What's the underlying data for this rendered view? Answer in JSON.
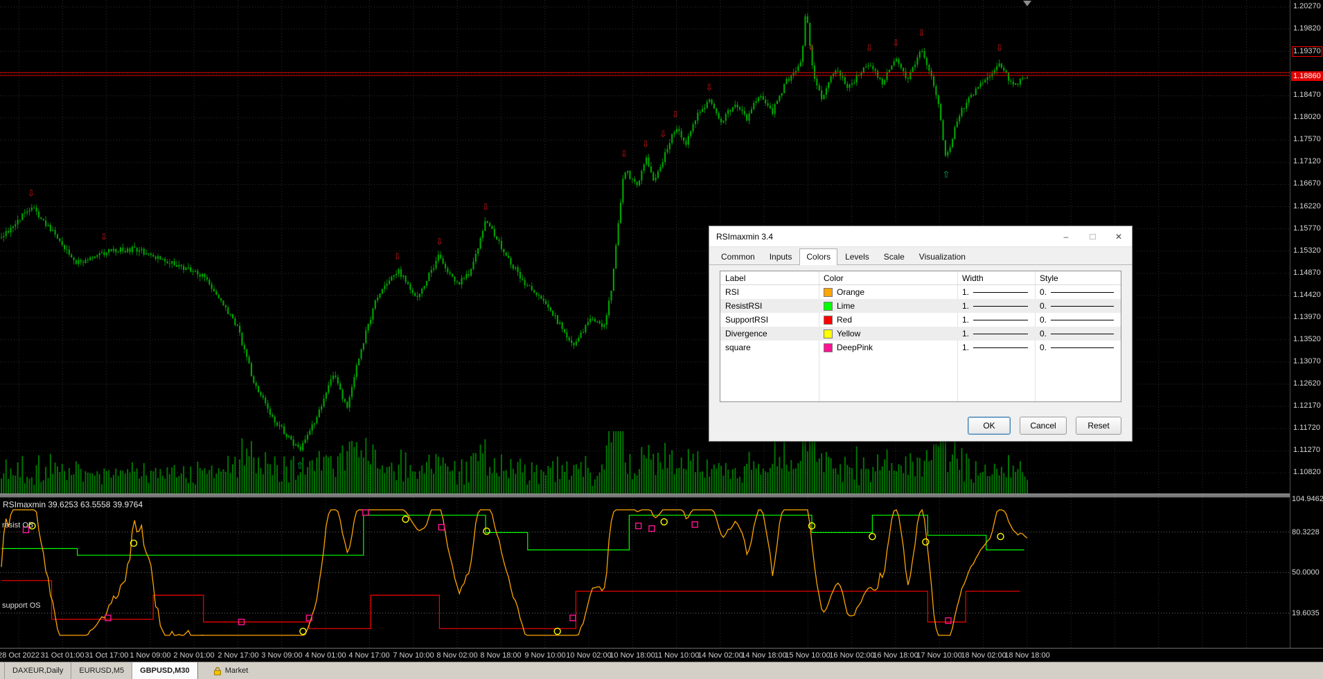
{
  "dialog": {
    "title": "RSImaxmin 3.4",
    "tabs": [
      "Common",
      "Inputs",
      "Colors",
      "Levels",
      "Scale",
      "Visualization"
    ],
    "active_tab": "Colors",
    "table": {
      "headers": [
        "Label",
        "Color",
        "Width",
        "Style"
      ],
      "rows": [
        {
          "label": "RSI",
          "color_name": "Orange",
          "color_hex": "#FFA500",
          "width": "1.",
          "style": "0."
        },
        {
          "label": "ResistRSI",
          "color_name": "Lime",
          "color_hex": "#00FF00",
          "width": "1.",
          "style": "0."
        },
        {
          "label": "SupportRSI",
          "color_name": "Red",
          "color_hex": "#FF0000",
          "width": "1.",
          "style": "0."
        },
        {
          "label": "Divergence",
          "color_name": "Yellow",
          "color_hex": "#FFFF00",
          "width": "1.",
          "style": "0."
        },
        {
          "label": "square",
          "color_name": "DeepPink",
          "color_hex": "#FF1493",
          "width": "1.",
          "style": "0."
        }
      ]
    },
    "buttons": {
      "ok": "OK",
      "cancel": "Cancel",
      "reset": "Reset"
    }
  },
  "price_scale": {
    "labels": [
      "1.20270",
      "1.19820",
      "1.19370",
      "1.18470",
      "1.18020",
      "1.17570",
      "1.17120",
      "1.16670",
      "1.16220",
      "1.15770",
      "1.15320",
      "1.14870",
      "1.14420",
      "1.13970",
      "1.13520",
      "1.13070",
      "1.12620",
      "1.12170",
      "1.11720",
      "1.11270",
      "1.10820"
    ],
    "alert_label": "1.19370",
    "bid_badge": "1.18860"
  },
  "time_axis": {
    "labels": [
      "28 Oct 2022",
      "31 Oct 01:00",
      "31 Oct 17:00",
      "1 Nov 09:00",
      "2 Nov 01:00",
      "2 Nov 17:00",
      "3 Nov 09:00",
      "4 Nov 01:00",
      "4 Nov 17:00",
      "7 Nov 10:00",
      "8 Nov 02:00",
      "8 Nov 18:00",
      "9 Nov 10:00",
      "10 Nov 02:00",
      "10 Nov 18:00",
      "11 Nov 10:00",
      "14 Nov 02:00",
      "14 Nov 18:00",
      "15 Nov 10:00",
      "16 Nov 02:00",
      "16 Nov 18:00",
      "17 Nov 10:00",
      "18 Nov 02:00",
      "18 Nov 18:00"
    ]
  },
  "indicator": {
    "title": "RSImaxmin 39.6253 63.5558 39.9764",
    "left_labels": {
      "ob": "resist OB",
      "os": "support OS"
    },
    "scale_labels": [
      "104.9462",
      "80.3228",
      "50.0000",
      "19.6035"
    ]
  },
  "status_bar": {
    "tabs": [
      "DAXEUR,Daily",
      "EURUSD,M5",
      "GBPUSD,M30"
    ],
    "active_tab": "GBPUSD,M30",
    "market_label": "Market"
  },
  "chart_data": {
    "type": "candlestick",
    "symbol": "GBPUSD,M30",
    "price_axis": {
      "top": 1.2027,
      "step": 0.0045,
      "rows": 22
    },
    "bid_line": 1.1888,
    "ask_line": 1.1894,
    "shift_fraction": 0.796,
    "candles": 440,
    "price_keypoints": [
      [
        0,
        1.156
      ],
      [
        0.029,
        1.1622
      ],
      [
        0.05,
        1.157
      ],
      [
        0.074,
        1.1508
      ],
      [
        0.105,
        1.1532
      ],
      [
        0.131,
        1.1536
      ],
      [
        0.16,
        1.1512
      ],
      [
        0.197,
        1.1482
      ],
      [
        0.23,
        1.1378
      ],
      [
        0.246,
        1.1268
      ],
      [
        0.263,
        1.1198
      ],
      [
        0.291,
        1.1126
      ],
      [
        0.304,
        1.1182
      ],
      [
        0.324,
        1.1282
      ],
      [
        0.337,
        1.121
      ],
      [
        0.349,
        1.1322
      ],
      [
        0.365,
        1.1432
      ],
      [
        0.386,
        1.1494
      ],
      [
        0.406,
        1.1438
      ],
      [
        0.427,
        1.1524
      ],
      [
        0.443,
        1.1462
      ],
      [
        0.458,
        1.1492
      ],
      [
        0.472,
        1.1594
      ],
      [
        0.493,
        1.152
      ],
      [
        0.509,
        1.1468
      ],
      [
        0.53,
        1.1432
      ],
      [
        0.546,
        1.1376
      ],
      [
        0.558,
        1.1336
      ],
      [
        0.575,
        1.1402
      ],
      [
        0.587,
        1.1372
      ],
      [
        0.595,
        1.1458
      ],
      [
        0.607,
        1.17
      ],
      [
        0.62,
        1.1662
      ],
      [
        0.628,
        1.1722
      ],
      [
        0.636,
        1.1668
      ],
      [
        0.649,
        1.1742
      ],
      [
        0.657,
        1.1782
      ],
      [
        0.667,
        1.1748
      ],
      [
        0.677,
        1.1802
      ],
      [
        0.69,
        1.1838
      ],
      [
        0.702,
        1.179
      ],
      [
        0.714,
        1.1832
      ],
      [
        0.727,
        1.18
      ],
      [
        0.739,
        1.1852
      ],
      [
        0.751,
        1.1812
      ],
      [
        0.764,
        1.1872
      ],
      [
        0.78,
        1.1912
      ],
      [
        0.784,
        1.2022
      ],
      [
        0.792,
        1.1882
      ],
      [
        0.8,
        1.1842
      ],
      [
        0.813,
        1.1902
      ],
      [
        0.825,
        1.1862
      ],
      [
        0.846,
        1.1916
      ],
      [
        0.858,
        1.1872
      ],
      [
        0.872,
        1.1926
      ],
      [
        0.883,
        1.1882
      ],
      [
        0.897,
        1.1942
      ],
      [
        0.907,
        1.188
      ],
      [
        0.913,
        1.1836
      ],
      [
        0.921,
        1.1716
      ],
      [
        0.932,
        1.1802
      ],
      [
        0.944,
        1.1846
      ],
      [
        0.957,
        1.1872
      ],
      [
        0.973,
        1.1916
      ],
      [
        0.985,
        1.1866
      ],
      [
        1,
        1.1886
      ]
    ],
    "sell_arrows": [
      [
        0.029,
        1.165
      ],
      [
        0.1,
        1.1562
      ],
      [
        0.386,
        1.1522
      ],
      [
        0.427,
        1.1552
      ],
      [
        0.472,
        1.1622
      ],
      [
        0.607,
        1.173
      ],
      [
        0.628,
        1.175
      ],
      [
        0.645,
        1.177
      ],
      [
        0.657,
        1.181
      ],
      [
        0.69,
        1.1865
      ],
      [
        0.79,
        1.1945
      ],
      [
        0.846,
        1.1945
      ],
      [
        0.872,
        1.1955
      ],
      [
        0.897,
        1.1975
      ],
      [
        0.973,
        1.1945
      ]
    ],
    "buy_arrows": [
      [
        0.291,
        1.1098
      ],
      [
        0.921,
        1.1688
      ]
    ],
    "indicator": {
      "name": "RSImaxmin",
      "values": [
        39.6253,
        63.5558,
        39.9764
      ],
      "scale": [
        104.9462,
        80.3228,
        50.0,
        19.6035
      ],
      "level_lines": [
        80.3228,
        50.0,
        19.6035
      ],
      "resist_segments": [
        [
          0,
          0.074,
          68
        ],
        [
          0.074,
          0.353,
          63
        ],
        [
          0.353,
          0.472,
          93
        ],
        [
          0.472,
          0.513,
          80
        ],
        [
          0.513,
          0.612,
          67
        ],
        [
          0.612,
          0.79,
          93
        ],
        [
          0.79,
          0.849,
          80
        ],
        [
          0.849,
          0.903,
          93
        ],
        [
          0.903,
          0.96,
          78
        ],
        [
          0.96,
          0.997,
          67
        ]
      ],
      "support_segments": [
        [
          0,
          0.049,
          44
        ],
        [
          0.049,
          0.148,
          15
        ],
        [
          0.148,
          0.197,
          33
        ],
        [
          0.197,
          0.3,
          13
        ],
        [
          0.3,
          0.36,
          8
        ],
        [
          0.36,
          0.427,
          33
        ],
        [
          0.427,
          0.56,
          8
        ],
        [
          0.56,
          0.903,
          36
        ],
        [
          0.903,
          0.94,
          13
        ],
        [
          0.94,
          0.993,
          36
        ]
      ],
      "divergence_circles": [
        [
          0.03,
          85
        ],
        [
          0.129,
          72
        ],
        [
          0.294,
          6
        ],
        [
          0.394,
          90
        ],
        [
          0.473,
          81
        ],
        [
          0.542,
          6
        ],
        [
          0.646,
          88
        ],
        [
          0.79,
          85
        ],
        [
          0.849,
          77
        ],
        [
          0.901,
          73
        ],
        [
          0.974,
          77
        ]
      ],
      "squares": [
        [
          0.024,
          82
        ],
        [
          0.104,
          16
        ],
        [
          0.234,
          13
        ],
        [
          0.3,
          16
        ],
        [
          0.355,
          95
        ],
        [
          0.429,
          84
        ],
        [
          0.557,
          16
        ],
        [
          0.621,
          85
        ],
        [
          0.634,
          83
        ],
        [
          0.676,
          86
        ],
        [
          0.923,
          14
        ]
      ]
    },
    "colors": {
      "candle_body": "#00a300",
      "candle_wick": "#008f00",
      "volume": "#007500",
      "grid": "#2f2f2f",
      "level_dots": "#6f6f6f",
      "bid_line": "#e00000",
      "rsi": "#FFA500",
      "resist": "#00FF00",
      "support": "#FF0000",
      "divergence": "#FFFF00",
      "square": "#FF1493",
      "sell_arrow": "#cc1111",
      "buy_arrow": "#00b050"
    }
  }
}
